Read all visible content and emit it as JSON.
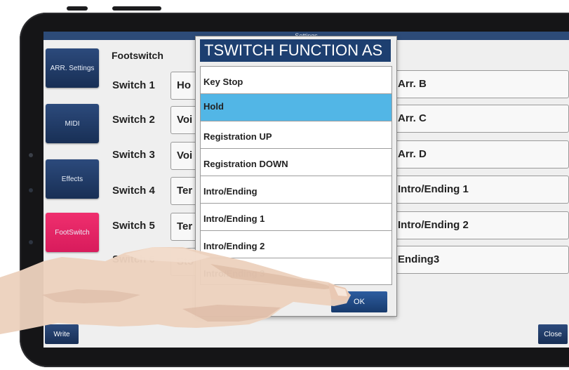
{
  "window": {
    "title": "Settings"
  },
  "sidebar": {
    "items": [
      {
        "label": "ARR. Settings"
      },
      {
        "label": "MIDI"
      },
      {
        "label": "Effects"
      },
      {
        "label": "FootSwitch"
      }
    ]
  },
  "main": {
    "section_title": "Footswitch",
    "switches": [
      {
        "label": "Switch 1",
        "left_value": "Ho",
        "right_value": "Arr. B"
      },
      {
        "label": "Switch 2",
        "left_value": "Voi",
        "right_value": "Arr. C"
      },
      {
        "label": "Switch 3",
        "left_value": "Voi",
        "right_value": "Arr. D"
      },
      {
        "label": "Switch 4",
        "left_value": "Ter",
        "right_value": "Intro/Ending 1"
      },
      {
        "label": "Switch 5",
        "left_value": "Ter",
        "right_value": "Intro/Ending 2"
      },
      {
        "label": "Switch 6",
        "left_value": "Sto",
        "right_value": "Ending3"
      }
    ]
  },
  "footer": {
    "write_label": "Write",
    "close_label": "Close"
  },
  "dialog": {
    "title": "TSWITCH FUNCTION AS",
    "options": [
      {
        "label": "Key Stop"
      },
      {
        "label": "Hold",
        "selected": true
      },
      {
        "label": "Registration UP"
      },
      {
        "label": "Registration DOWN"
      },
      {
        "label": "Intro/Ending"
      },
      {
        "label": "Intro/Ending 1"
      },
      {
        "label": "Intro/Ending 2"
      },
      {
        "label": "Intro/Ending 3"
      }
    ],
    "ok_label": "OK"
  },
  "colors": {
    "nav_blue": "#1f3a66",
    "nav_active_pink": "#e8286a",
    "selection_blue": "#52b6e6",
    "dialog_title_bg": "#1d3f70"
  }
}
